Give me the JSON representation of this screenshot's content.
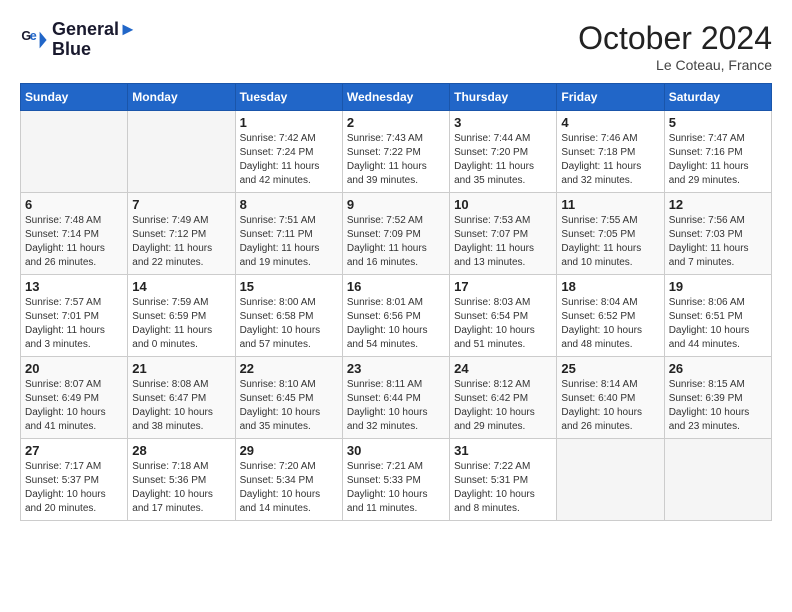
{
  "header": {
    "logo_line1": "General",
    "logo_line2": "Blue",
    "month_title": "October 2024",
    "location": "Le Coteau, France"
  },
  "weekdays": [
    "Sunday",
    "Monday",
    "Tuesday",
    "Wednesday",
    "Thursday",
    "Friday",
    "Saturday"
  ],
  "weeks": [
    [
      {
        "day": "",
        "sunrise": "",
        "sunset": "",
        "daylight": ""
      },
      {
        "day": "",
        "sunrise": "",
        "sunset": "",
        "daylight": ""
      },
      {
        "day": "1",
        "sunrise": "Sunrise: 7:42 AM",
        "sunset": "Sunset: 7:24 PM",
        "daylight": "Daylight: 11 hours and 42 minutes."
      },
      {
        "day": "2",
        "sunrise": "Sunrise: 7:43 AM",
        "sunset": "Sunset: 7:22 PM",
        "daylight": "Daylight: 11 hours and 39 minutes."
      },
      {
        "day": "3",
        "sunrise": "Sunrise: 7:44 AM",
        "sunset": "Sunset: 7:20 PM",
        "daylight": "Daylight: 11 hours and 35 minutes."
      },
      {
        "day": "4",
        "sunrise": "Sunrise: 7:46 AM",
        "sunset": "Sunset: 7:18 PM",
        "daylight": "Daylight: 11 hours and 32 minutes."
      },
      {
        "day": "5",
        "sunrise": "Sunrise: 7:47 AM",
        "sunset": "Sunset: 7:16 PM",
        "daylight": "Daylight: 11 hours and 29 minutes."
      }
    ],
    [
      {
        "day": "6",
        "sunrise": "Sunrise: 7:48 AM",
        "sunset": "Sunset: 7:14 PM",
        "daylight": "Daylight: 11 hours and 26 minutes."
      },
      {
        "day": "7",
        "sunrise": "Sunrise: 7:49 AM",
        "sunset": "Sunset: 7:12 PM",
        "daylight": "Daylight: 11 hours and 22 minutes."
      },
      {
        "day": "8",
        "sunrise": "Sunrise: 7:51 AM",
        "sunset": "Sunset: 7:11 PM",
        "daylight": "Daylight: 11 hours and 19 minutes."
      },
      {
        "day": "9",
        "sunrise": "Sunrise: 7:52 AM",
        "sunset": "Sunset: 7:09 PM",
        "daylight": "Daylight: 11 hours and 16 minutes."
      },
      {
        "day": "10",
        "sunrise": "Sunrise: 7:53 AM",
        "sunset": "Sunset: 7:07 PM",
        "daylight": "Daylight: 11 hours and 13 minutes."
      },
      {
        "day": "11",
        "sunrise": "Sunrise: 7:55 AM",
        "sunset": "Sunset: 7:05 PM",
        "daylight": "Daylight: 11 hours and 10 minutes."
      },
      {
        "day": "12",
        "sunrise": "Sunrise: 7:56 AM",
        "sunset": "Sunset: 7:03 PM",
        "daylight": "Daylight: 11 hours and 7 minutes."
      }
    ],
    [
      {
        "day": "13",
        "sunrise": "Sunrise: 7:57 AM",
        "sunset": "Sunset: 7:01 PM",
        "daylight": "Daylight: 11 hours and 3 minutes."
      },
      {
        "day": "14",
        "sunrise": "Sunrise: 7:59 AM",
        "sunset": "Sunset: 6:59 PM",
        "daylight": "Daylight: 11 hours and 0 minutes."
      },
      {
        "day": "15",
        "sunrise": "Sunrise: 8:00 AM",
        "sunset": "Sunset: 6:58 PM",
        "daylight": "Daylight: 10 hours and 57 minutes."
      },
      {
        "day": "16",
        "sunrise": "Sunrise: 8:01 AM",
        "sunset": "Sunset: 6:56 PM",
        "daylight": "Daylight: 10 hours and 54 minutes."
      },
      {
        "day": "17",
        "sunrise": "Sunrise: 8:03 AM",
        "sunset": "Sunset: 6:54 PM",
        "daylight": "Daylight: 10 hours and 51 minutes."
      },
      {
        "day": "18",
        "sunrise": "Sunrise: 8:04 AM",
        "sunset": "Sunset: 6:52 PM",
        "daylight": "Daylight: 10 hours and 48 minutes."
      },
      {
        "day": "19",
        "sunrise": "Sunrise: 8:06 AM",
        "sunset": "Sunset: 6:51 PM",
        "daylight": "Daylight: 10 hours and 44 minutes."
      }
    ],
    [
      {
        "day": "20",
        "sunrise": "Sunrise: 8:07 AM",
        "sunset": "Sunset: 6:49 PM",
        "daylight": "Daylight: 10 hours and 41 minutes."
      },
      {
        "day": "21",
        "sunrise": "Sunrise: 8:08 AM",
        "sunset": "Sunset: 6:47 PM",
        "daylight": "Daylight: 10 hours and 38 minutes."
      },
      {
        "day": "22",
        "sunrise": "Sunrise: 8:10 AM",
        "sunset": "Sunset: 6:45 PM",
        "daylight": "Daylight: 10 hours and 35 minutes."
      },
      {
        "day": "23",
        "sunrise": "Sunrise: 8:11 AM",
        "sunset": "Sunset: 6:44 PM",
        "daylight": "Daylight: 10 hours and 32 minutes."
      },
      {
        "day": "24",
        "sunrise": "Sunrise: 8:12 AM",
        "sunset": "Sunset: 6:42 PM",
        "daylight": "Daylight: 10 hours and 29 minutes."
      },
      {
        "day": "25",
        "sunrise": "Sunrise: 8:14 AM",
        "sunset": "Sunset: 6:40 PM",
        "daylight": "Daylight: 10 hours and 26 minutes."
      },
      {
        "day": "26",
        "sunrise": "Sunrise: 8:15 AM",
        "sunset": "Sunset: 6:39 PM",
        "daylight": "Daylight: 10 hours and 23 minutes."
      }
    ],
    [
      {
        "day": "27",
        "sunrise": "Sunrise: 7:17 AM",
        "sunset": "Sunset: 5:37 PM",
        "daylight": "Daylight: 10 hours and 20 minutes."
      },
      {
        "day": "28",
        "sunrise": "Sunrise: 7:18 AM",
        "sunset": "Sunset: 5:36 PM",
        "daylight": "Daylight: 10 hours and 17 minutes."
      },
      {
        "day": "29",
        "sunrise": "Sunrise: 7:20 AM",
        "sunset": "Sunset: 5:34 PM",
        "daylight": "Daylight: 10 hours and 14 minutes."
      },
      {
        "day": "30",
        "sunrise": "Sunrise: 7:21 AM",
        "sunset": "Sunset: 5:33 PM",
        "daylight": "Daylight: 10 hours and 11 minutes."
      },
      {
        "day": "31",
        "sunrise": "Sunrise: 7:22 AM",
        "sunset": "Sunset: 5:31 PM",
        "daylight": "Daylight: 10 hours and 8 minutes."
      },
      {
        "day": "",
        "sunrise": "",
        "sunset": "",
        "daylight": ""
      },
      {
        "day": "",
        "sunrise": "",
        "sunset": "",
        "daylight": ""
      }
    ]
  ]
}
